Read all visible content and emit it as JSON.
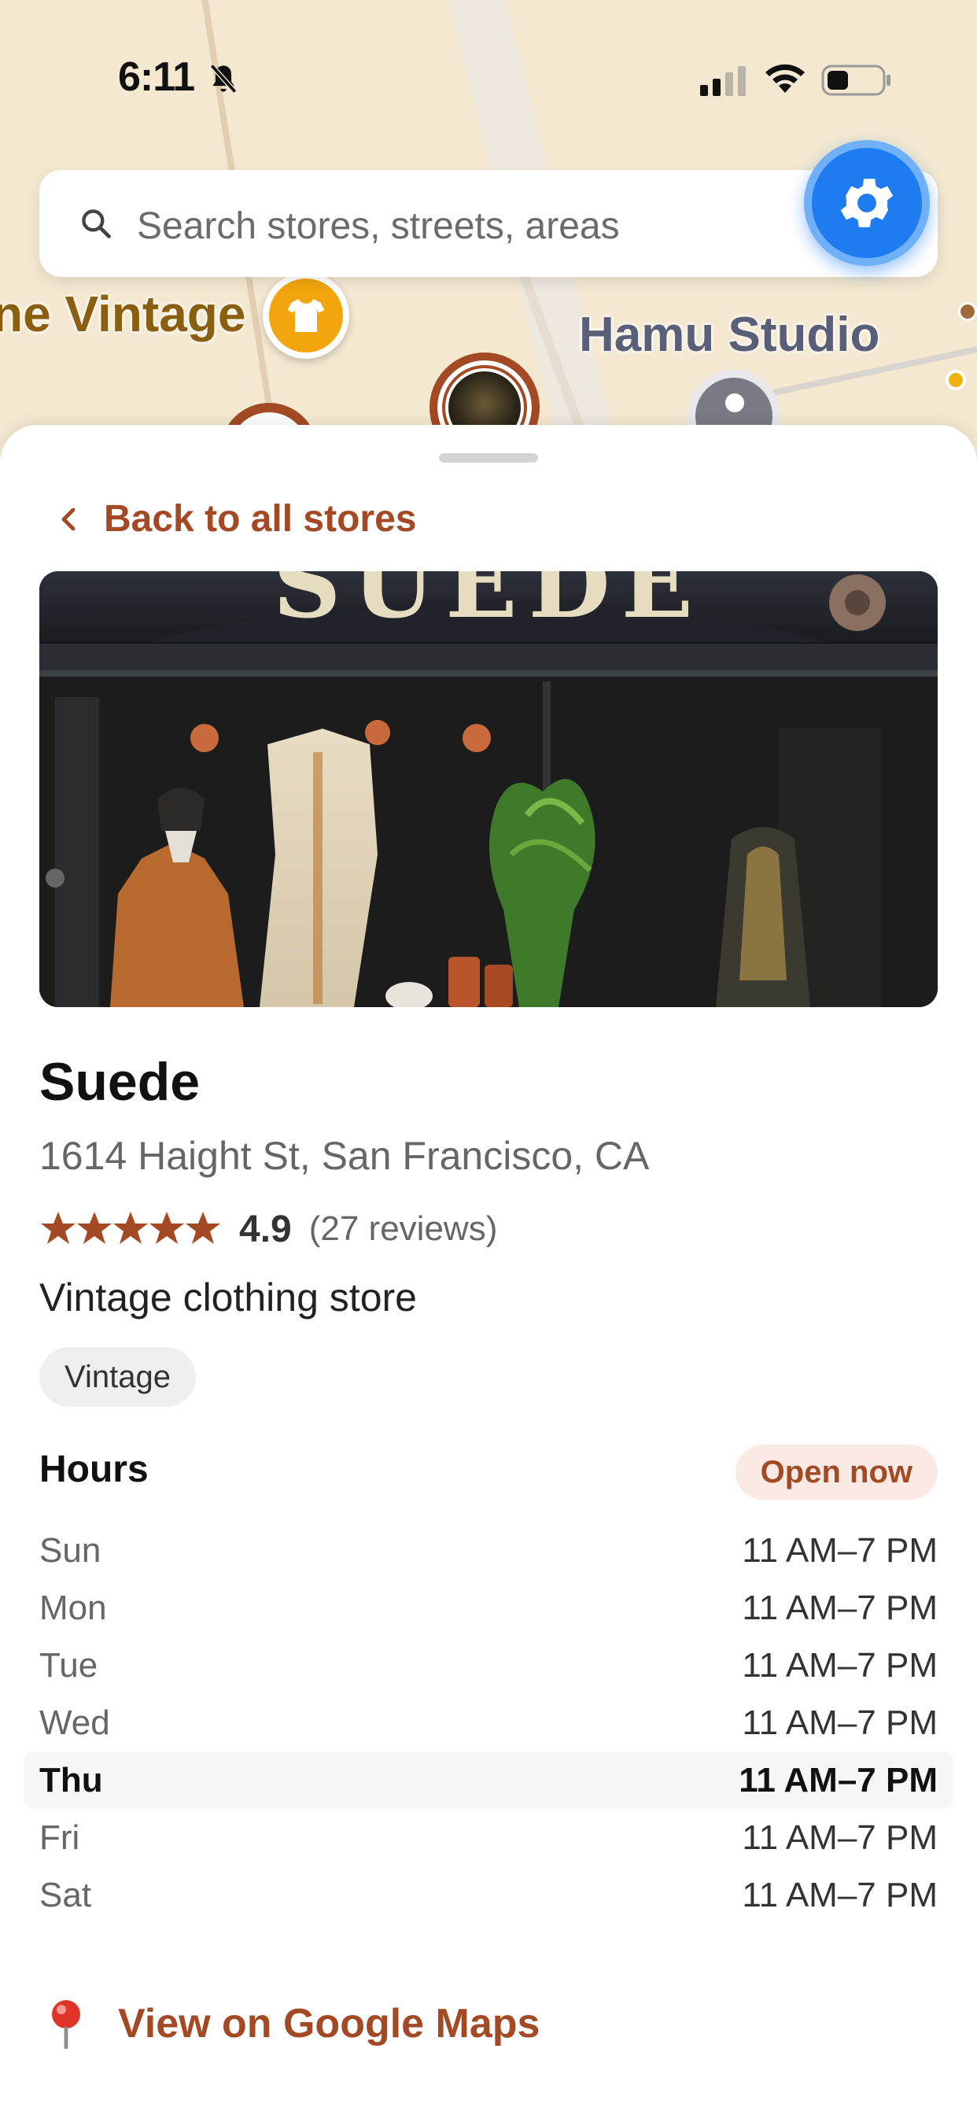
{
  "status_bar": {
    "time": "6:11"
  },
  "search": {
    "placeholder": "Search stores, streets, areas"
  },
  "map": {
    "labels": {
      "vintage": "ne Vintage",
      "hamu": "Hamu Studio"
    },
    "pin_icons": [
      "shirt-icon",
      "store-photo-pin",
      "pin",
      "location-pin"
    ]
  },
  "sheet": {
    "back_label": "Back to all stores"
  },
  "store": {
    "name": "Suede",
    "photo_sign": "SUEDE",
    "address": "1614 Haight St, San Francisco, CA",
    "rating": "4.9",
    "rating_value": 4.9,
    "reviews": "(27 reviews)",
    "category": "Vintage clothing store",
    "tag": "Vintage"
  },
  "hours": {
    "title": "Hours",
    "status": "Open now",
    "rows": [
      {
        "day": "Sun",
        "time": "11 AM–7 PM"
      },
      {
        "day": "Mon",
        "time": "11 AM–7 PM"
      },
      {
        "day": "Tue",
        "time": "11 AM–7 PM"
      },
      {
        "day": "Wed",
        "time": "11 AM–7 PM"
      },
      {
        "day": "Thu",
        "time": "11 AM–7 PM",
        "today": true
      },
      {
        "day": "Fri",
        "time": "11 AM–7 PM"
      },
      {
        "day": "Sat",
        "time": "11 AM–7 PM"
      }
    ]
  },
  "actions": {
    "maps_label": "View on Google Maps"
  },
  "colors": {
    "accent": "#a34a24",
    "settings_blue": "#1e7cf0",
    "pin_yellow": "#f2a50c",
    "map_background": "#f4e8d0"
  }
}
